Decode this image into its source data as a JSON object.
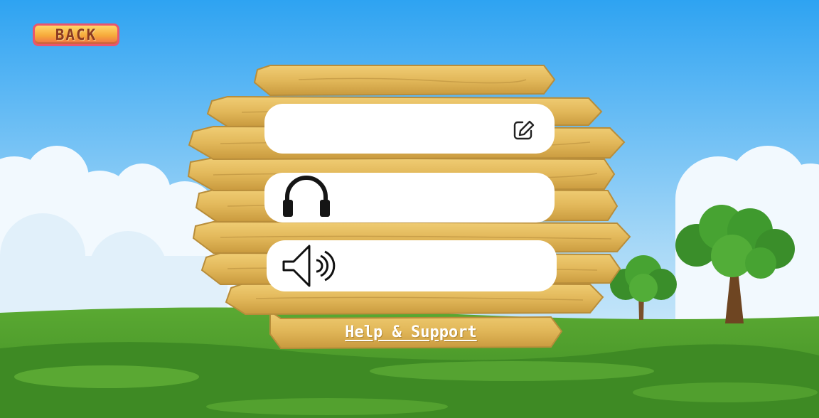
{
  "back_button": {
    "label": "BACK"
  },
  "profile_field": {
    "icon": "edit-icon"
  },
  "music_field": {
    "icon": "headphones-icon"
  },
  "sound_field": {
    "icon": "speaker-icon"
  },
  "help_link": {
    "label": "Help & Support"
  },
  "colors": {
    "sky_top": "#2ea3f2",
    "grass": "#4f9e2c",
    "wood": "#e2b85a",
    "wood_edge": "#b88d3a",
    "back_button": "#f6a93a"
  }
}
